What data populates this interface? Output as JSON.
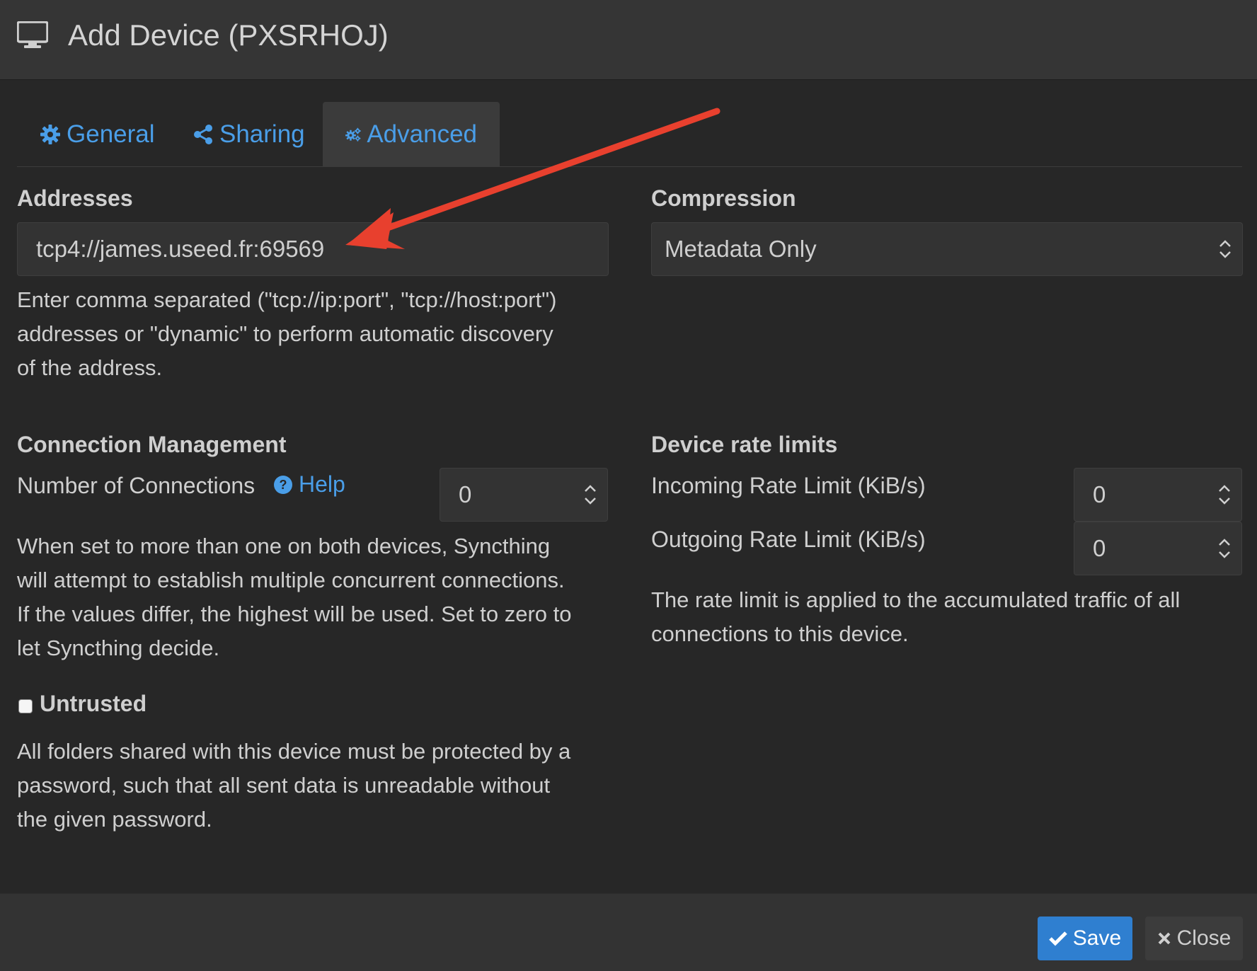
{
  "header": {
    "title": "Add Device (PXSRHOJ)",
    "icon": "desktop-icon"
  },
  "tabs": [
    {
      "label": "General",
      "icon": "gear-icon",
      "active": false
    },
    {
      "label": "Sharing",
      "icon": "share-icon",
      "active": false
    },
    {
      "label": "Advanced",
      "icon": "gears-icon",
      "active": true
    }
  ],
  "addresses": {
    "label": "Addresses",
    "value": "tcp4://james.useed.fr:69569",
    "help_line1": "Enter comma separated (\"tcp://ip:port\", \"tcp://host:port\")",
    "help_line2": "addresses or \"dynamic\" to perform automatic discovery",
    "help_line3": "of the address."
  },
  "compression": {
    "label": "Compression",
    "selected": "Metadata Only"
  },
  "connection_management": {
    "label": "Connection Management",
    "num_connections_label": "Number of Connections",
    "help_link": "Help",
    "num_connections_value": "0",
    "desc_line1": "When set to more than one on both devices, Syncthing",
    "desc_line2": "will attempt to establish multiple concurrent connections.",
    "desc_line3": "If the values differ, the highest will be used. Set to zero to",
    "desc_line4": "let Syncthing decide."
  },
  "rate_limits": {
    "label": "Device rate limits",
    "incoming_label": "Incoming Rate Limit (KiB/s)",
    "incoming_value": "0",
    "outgoing_label": "Outgoing Rate Limit (KiB/s)",
    "outgoing_value": "0",
    "desc_line1": "The rate limit is applied to the accumulated traffic of all",
    "desc_line2": "connections to this device."
  },
  "untrusted": {
    "label": "Untrusted",
    "checked": false,
    "desc_line1": "All folders shared with this device must be protected by a",
    "desc_line2": "password, such that all sent data is unreadable without",
    "desc_line3": "the given password."
  },
  "footer": {
    "save_label": "Save",
    "close_label": "Close"
  },
  "colors": {
    "accent": "#4a9ee8",
    "save_button": "#2f7fd0",
    "annotation_arrow": "#e8402e"
  }
}
